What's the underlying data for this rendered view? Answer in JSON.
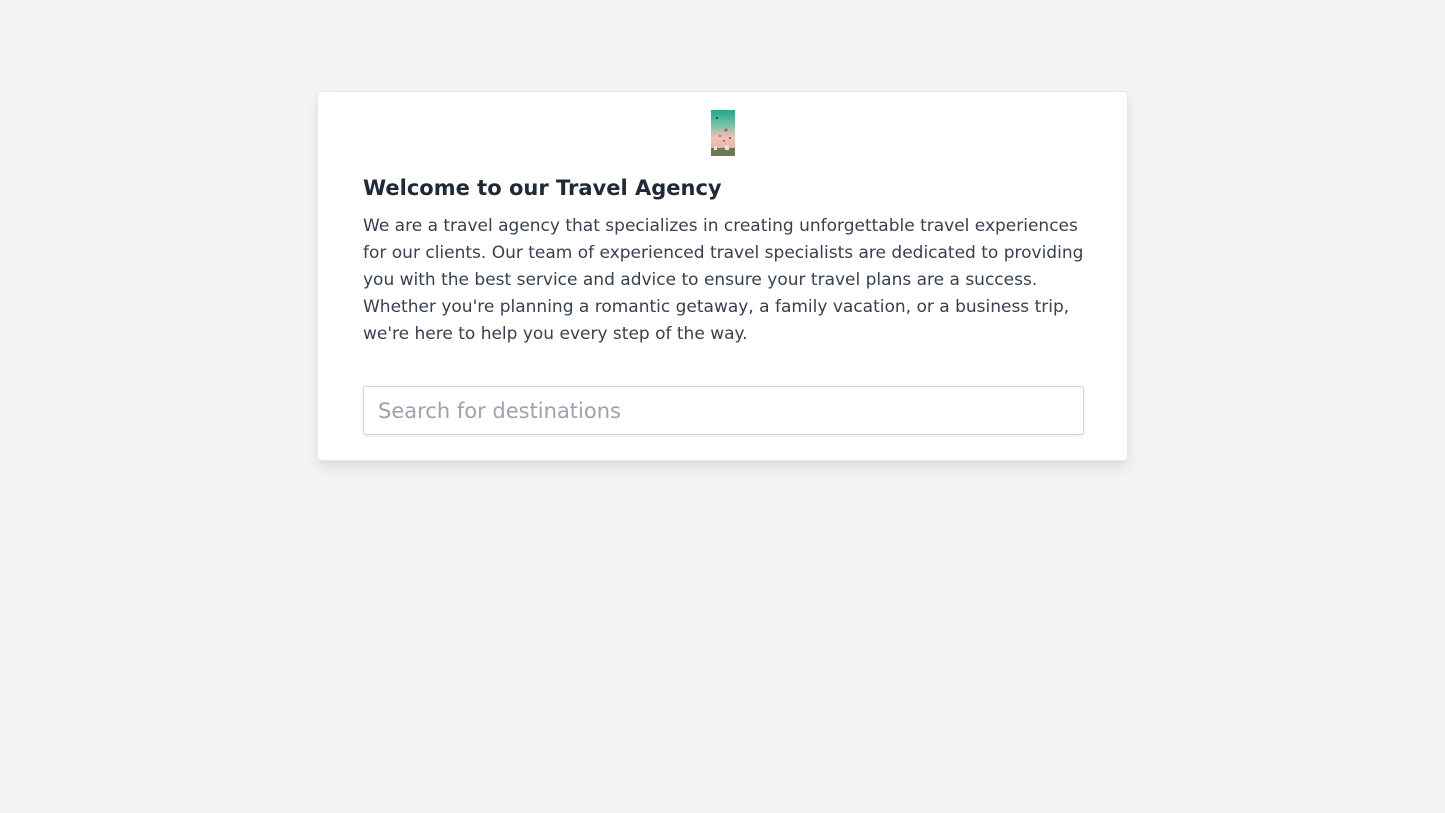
{
  "card": {
    "logo_icon": "hot-air-balloons-image",
    "title": "Welcome to our Travel Agency",
    "description": "We are a travel agency that specializes in creating unforgettable travel experiences for our clients. Our team of experienced travel specialists are dedicated to providing you with the best service and advice to ensure your travel plans are a success. Whether you're planning a romantic getaway, a family vacation, or a business trip, we're here to help you every step of the way."
  },
  "search": {
    "placeholder": "Search for destinations",
    "value": ""
  },
  "colors": {
    "page_background": "#f3f4f6",
    "card_background": "#ffffff",
    "title_text": "#1f2937",
    "body_text": "#374151",
    "placeholder_text": "#9ca3af",
    "border": "#d1d5db"
  }
}
